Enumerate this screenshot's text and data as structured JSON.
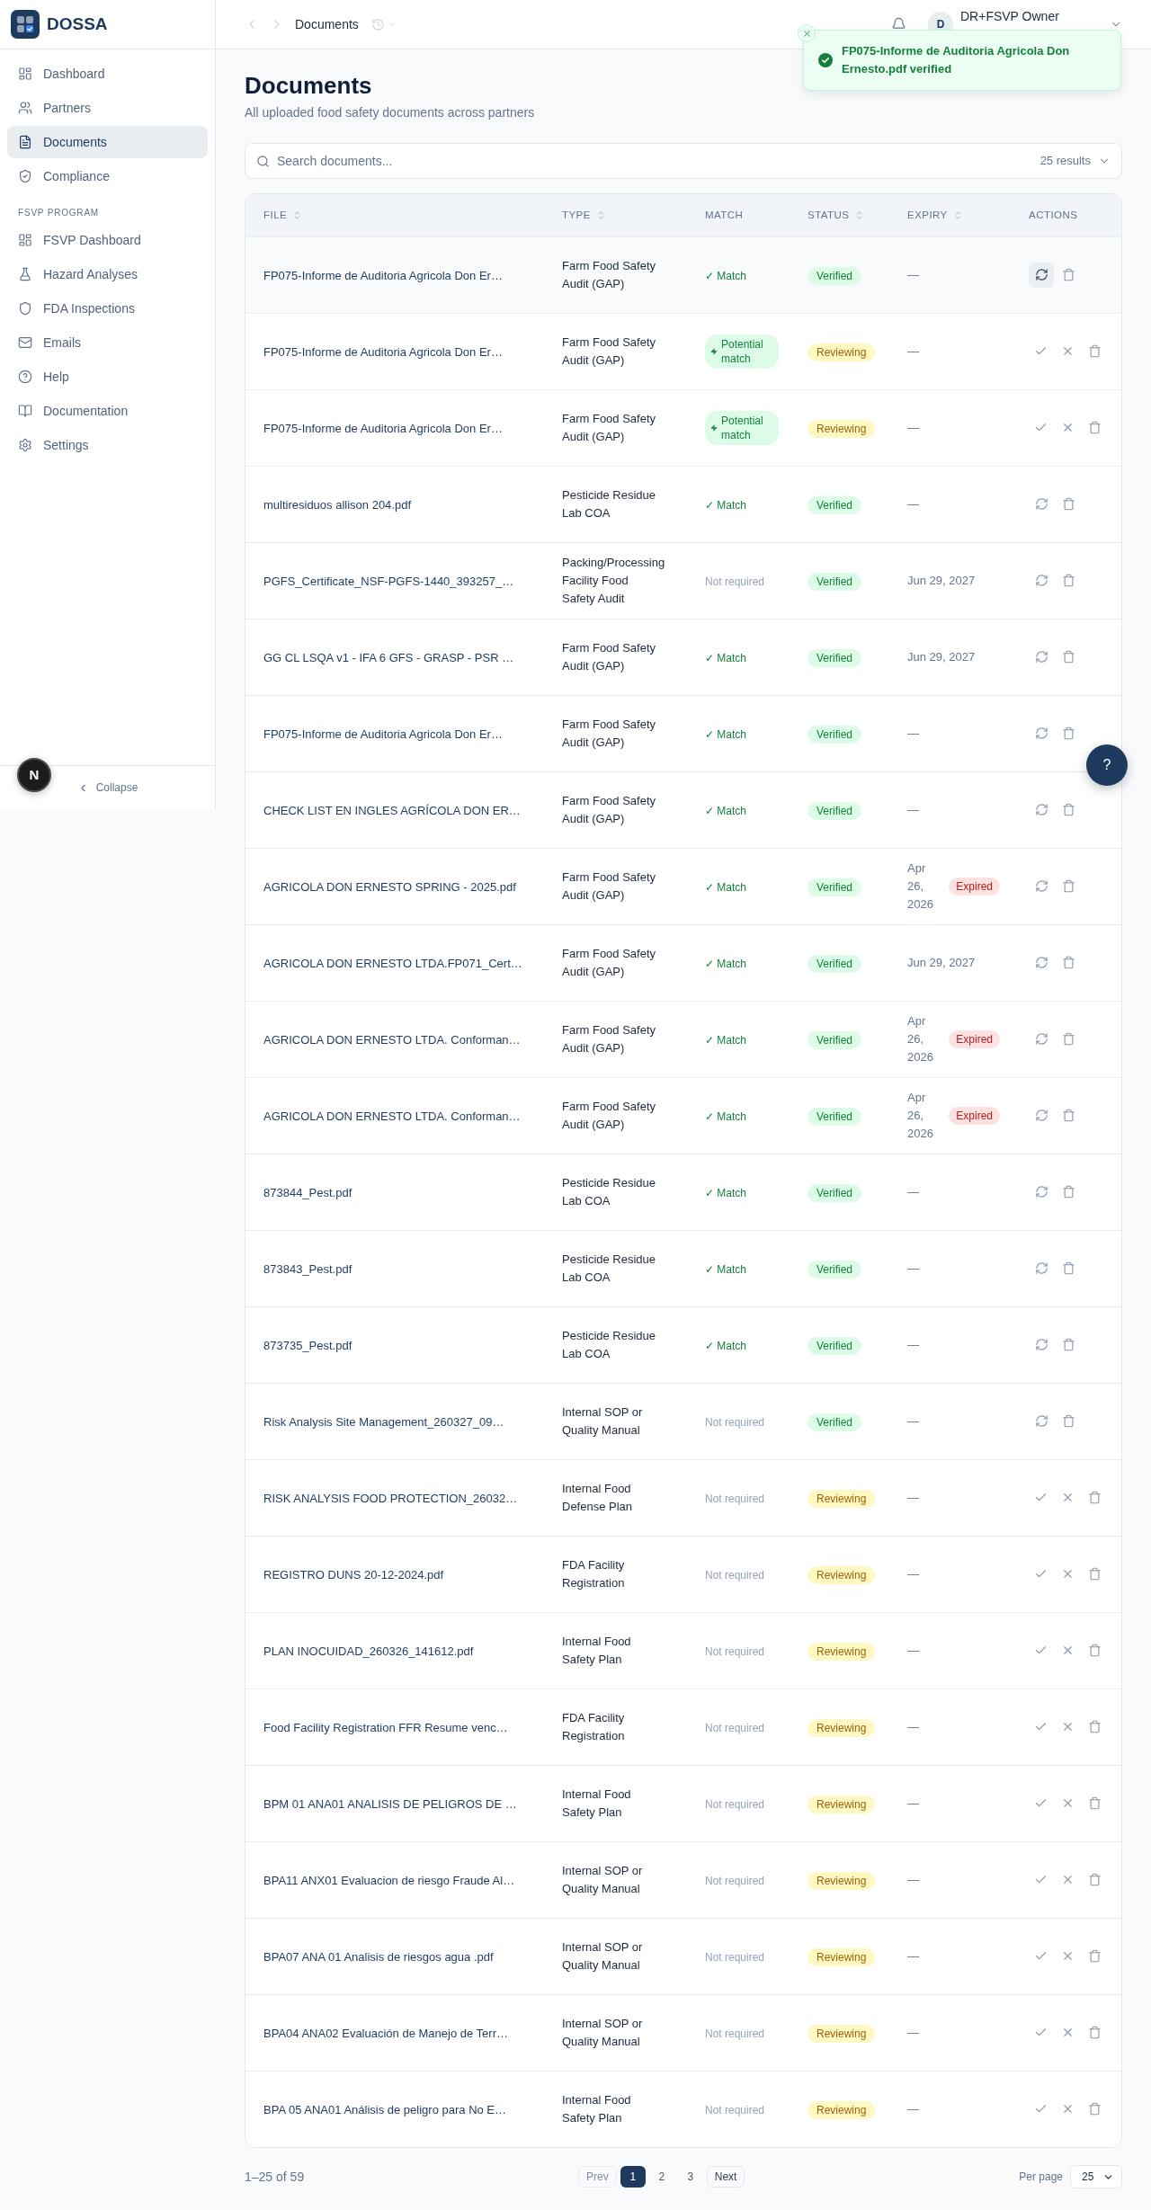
{
  "sidebar": {
    "brand": "DOSSA",
    "sections": [
      {
        "items": [
          {
            "label": "Dashboard",
            "selected": false
          },
          {
            "label": "Partners",
            "selected": false
          },
          {
            "label": "Documents",
            "selected": true
          },
          {
            "label": "Compliance",
            "selected": false
          }
        ]
      },
      {
        "title": "FSVP PROGRAM",
        "items": [
          {
            "label": "FSVP Dashboard",
            "selected": false
          },
          {
            "label": "Hazard Analyses",
            "selected": false
          },
          {
            "label": "FDA Inspections",
            "selected": false
          },
          {
            "label": "Emails",
            "selected": false
          },
          {
            "label": "Help",
            "selected": false
          },
          {
            "label": "Documentation",
            "selected": false
          },
          {
            "label": "Settings",
            "selected": false
          }
        ]
      }
    ],
    "collapse": "Collapse"
  },
  "dev_badge": "N",
  "header": {
    "breadcrumb": "Documents",
    "user": {
      "initial": "D",
      "name": "DR+FSVP Owner"
    }
  },
  "toast": {
    "message": "FP075-Informe de Auditoria Agricola Don Ernesto.pdf verified"
  },
  "page": {
    "title": "Documents",
    "subtitle": "All uploaded food safety documents across partners"
  },
  "search": {
    "placeholder": "Search documents...",
    "results": "25 results"
  },
  "table": {
    "columns": [
      {
        "label": "FILE",
        "sortable": true
      },
      {
        "label": "TYPE",
        "sortable": true
      },
      {
        "label": "MATCH",
        "sortable": false
      },
      {
        "label": "STATUS",
        "sortable": true
      },
      {
        "label": "EXPIRY",
        "sortable": true
      },
      {
        "label": "ACTIONS",
        "sortable": false
      }
    ],
    "rows": [
      {
        "file": "FP075-Informe de Auditoria Agricola Don Er…",
        "type": "Farm Food Safety Audit (GAP)",
        "match": {
          "kind": "match",
          "label": "✓ Match"
        },
        "status": {
          "kind": "verified",
          "label": "Verified"
        },
        "expiry": "—",
        "hovered": true
      },
      {
        "file": "FP075-Informe de Auditoria Agricola Don Er…",
        "type": "Farm Food Safety Audit (GAP)",
        "match": {
          "kind": "potential",
          "label": "Potential match"
        },
        "status": {
          "kind": "reviewing",
          "label": "Reviewing"
        },
        "expiry": "—",
        "hovered": false
      },
      {
        "file": "FP075-Informe de Auditoria Agricola Don Er…",
        "type": "Farm Food Safety Audit (GAP)",
        "match": {
          "kind": "potential",
          "label": "Potential match"
        },
        "status": {
          "kind": "reviewing",
          "label": "Reviewing"
        },
        "expiry": "—",
        "hovered": false
      },
      {
        "file": "multiresiduos allison 204.pdf",
        "type": "Pesticide Residue Lab COA",
        "match": {
          "kind": "match",
          "label": "✓ Match"
        },
        "status": {
          "kind": "verified",
          "label": "Verified"
        },
        "expiry": "—",
        "hovered": false
      },
      {
        "file": "PGFS_Certificate_NSF-PGFS-1440_393257_…",
        "type": "Packing/Processing Facility Food Safety Audit",
        "match": {
          "kind": "not_required",
          "label": "Not required"
        },
        "status": {
          "kind": "verified",
          "label": "Verified"
        },
        "expiry": "Jun 29, 2027",
        "hovered": false
      },
      {
        "file": "GG CL LSQA v1 - IFA 6 GFS - GRASP - PSR …",
        "type": "Farm Food Safety Audit (GAP)",
        "match": {
          "kind": "match",
          "label": "✓ Match"
        },
        "status": {
          "kind": "verified",
          "label": "Verified"
        },
        "expiry": "Jun 29, 2027",
        "hovered": false
      },
      {
        "file": "FP075-Informe de Auditoria Agricola Don Er…",
        "type": "Farm Food Safety Audit (GAP)",
        "match": {
          "kind": "match",
          "label": "✓ Match"
        },
        "status": {
          "kind": "verified",
          "label": "Verified"
        },
        "expiry": "—",
        "hovered": false
      },
      {
        "file": "CHECK LIST EN INGLES AGRÍCOLA DON ER…",
        "type": "Farm Food Safety Audit (GAP)",
        "match": {
          "kind": "match",
          "label": "✓ Match"
        },
        "status": {
          "kind": "verified",
          "label": "Verified"
        },
        "expiry": "—",
        "hovered": false
      },
      {
        "file": "AGRICOLA DON ERNESTO SPRING - 2025.pdf",
        "type": "Farm Food Safety Audit (GAP)",
        "match": {
          "kind": "match",
          "label": "✓ Match"
        },
        "status": {
          "kind": "verified",
          "label": "Verified"
        },
        "expiry": "Apr 26, 2026",
        "expiry_badge": "Expired",
        "hovered": false
      },
      {
        "file": "AGRICOLA DON ERNESTO LTDA.FP071_Cert…",
        "type": "Farm Food Safety Audit (GAP)",
        "match": {
          "kind": "match",
          "label": "✓ Match"
        },
        "status": {
          "kind": "verified",
          "label": "Verified"
        },
        "expiry": "Jun 29, 2027",
        "hovered": false
      },
      {
        "file": "AGRICOLA DON ERNESTO LTDA. Conforman…",
        "type": "Farm Food Safety Audit (GAP)",
        "match": {
          "kind": "match",
          "label": "✓ Match"
        },
        "status": {
          "kind": "verified",
          "label": "Verified"
        },
        "expiry": "Apr 26, 2026",
        "expiry_badge": "Expired",
        "hovered": false
      },
      {
        "file": "AGRICOLA DON ERNESTO LTDA. Conforman…",
        "type": "Farm Food Safety Audit (GAP)",
        "match": {
          "kind": "match",
          "label": "✓ Match"
        },
        "status": {
          "kind": "verified",
          "label": "Verified"
        },
        "expiry": "Apr 26, 2026",
        "expiry_badge": "Expired",
        "hovered": false
      },
      {
        "file": "873844_Pest.pdf",
        "type": "Pesticide Residue Lab COA",
        "match": {
          "kind": "match",
          "label": "✓ Match"
        },
        "status": {
          "kind": "verified",
          "label": "Verified"
        },
        "expiry": "—",
        "hovered": false
      },
      {
        "file": "873843_Pest.pdf",
        "type": "Pesticide Residue Lab COA",
        "match": {
          "kind": "match",
          "label": "✓ Match"
        },
        "status": {
          "kind": "verified",
          "label": "Verified"
        },
        "expiry": "—",
        "hovered": false
      },
      {
        "file": "873735_Pest.pdf",
        "type": "Pesticide Residue Lab COA",
        "match": {
          "kind": "match",
          "label": "✓ Match"
        },
        "status": {
          "kind": "verified",
          "label": "Verified"
        },
        "expiry": "—",
        "hovered": false
      },
      {
        "file": "Risk Analysis Site Management_260327_09…",
        "type": "Internal SOP or Quality Manual",
        "match": {
          "kind": "not_required",
          "label": "Not required"
        },
        "status": {
          "kind": "verified",
          "label": "Verified"
        },
        "expiry": "—",
        "hovered": false
      },
      {
        "file": "RISK ANALYSIS FOOD PROTECTION_26032…",
        "type": "Internal Food Defense Plan",
        "match": {
          "kind": "not_required",
          "label": "Not required"
        },
        "status": {
          "kind": "reviewing",
          "label": "Reviewing"
        },
        "expiry": "—",
        "hovered": false
      },
      {
        "file": "REGISTRO DUNS 20-12-2024.pdf",
        "type": "FDA Facility Registration",
        "match": {
          "kind": "not_required",
          "label": "Not required"
        },
        "status": {
          "kind": "reviewing",
          "label": "Reviewing"
        },
        "expiry": "—",
        "hovered": false
      },
      {
        "file": "PLAN INOCUIDAD_260326_141612.pdf",
        "type": "Internal Food Safety Plan",
        "match": {
          "kind": "not_required",
          "label": "Not required"
        },
        "status": {
          "kind": "reviewing",
          "label": "Reviewing"
        },
        "expiry": "—",
        "hovered": false
      },
      {
        "file": "Food Facility Registration FFR Resume venc…",
        "type": "FDA Facility Registration",
        "match": {
          "kind": "not_required",
          "label": "Not required"
        },
        "status": {
          "kind": "reviewing",
          "label": "Reviewing"
        },
        "expiry": "—",
        "hovered": false
      },
      {
        "file": "BPM 01 ANA01 ANALISIS DE PELIGROS DE …",
        "type": "Internal Food Safety Plan",
        "match": {
          "kind": "not_required",
          "label": "Not required"
        },
        "status": {
          "kind": "reviewing",
          "label": "Reviewing"
        },
        "expiry": "—",
        "hovered": false
      },
      {
        "file": "BPA11 ANX01 Evaluacion de riesgo Fraude Al…",
        "type": "Internal SOP or Quality Manual",
        "match": {
          "kind": "not_required",
          "label": "Not required"
        },
        "status": {
          "kind": "reviewing",
          "label": "Reviewing"
        },
        "expiry": "—",
        "hovered": false
      },
      {
        "file": "BPA07 ANA 01 Analisis de riesgos agua .pdf",
        "type": "Internal SOP or Quality Manual",
        "match": {
          "kind": "not_required",
          "label": "Not required"
        },
        "status": {
          "kind": "reviewing",
          "label": "Reviewing"
        },
        "expiry": "—",
        "hovered": false
      },
      {
        "file": "BPA04 ANA02 Evaluación de Manejo de Terr…",
        "type": "Internal SOP or Quality Manual",
        "match": {
          "kind": "not_required",
          "label": "Not required"
        },
        "status": {
          "kind": "reviewing",
          "label": "Reviewing"
        },
        "expiry": "—",
        "hovered": false
      },
      {
        "file": "BPA 05 ANA01 Análisis de peligro para No E…",
        "type": "Internal Food Safety Plan",
        "match": {
          "kind": "not_required",
          "label": "Not required"
        },
        "status": {
          "kind": "reviewing",
          "label": "Reviewing"
        },
        "expiry": "—",
        "hovered": false
      }
    ]
  },
  "pagination": {
    "range": "1–25 of 59",
    "prev": {
      "label": "Prev",
      "disabled": true
    },
    "pages": [
      {
        "label": "1",
        "selected": true
      },
      {
        "label": "2",
        "selected": false
      },
      {
        "label": "3",
        "selected": false
      }
    ],
    "next": {
      "label": "Next",
      "disabled": false
    },
    "per_page_label": "Per page",
    "per_page": "25"
  },
  "help_button": "?"
}
